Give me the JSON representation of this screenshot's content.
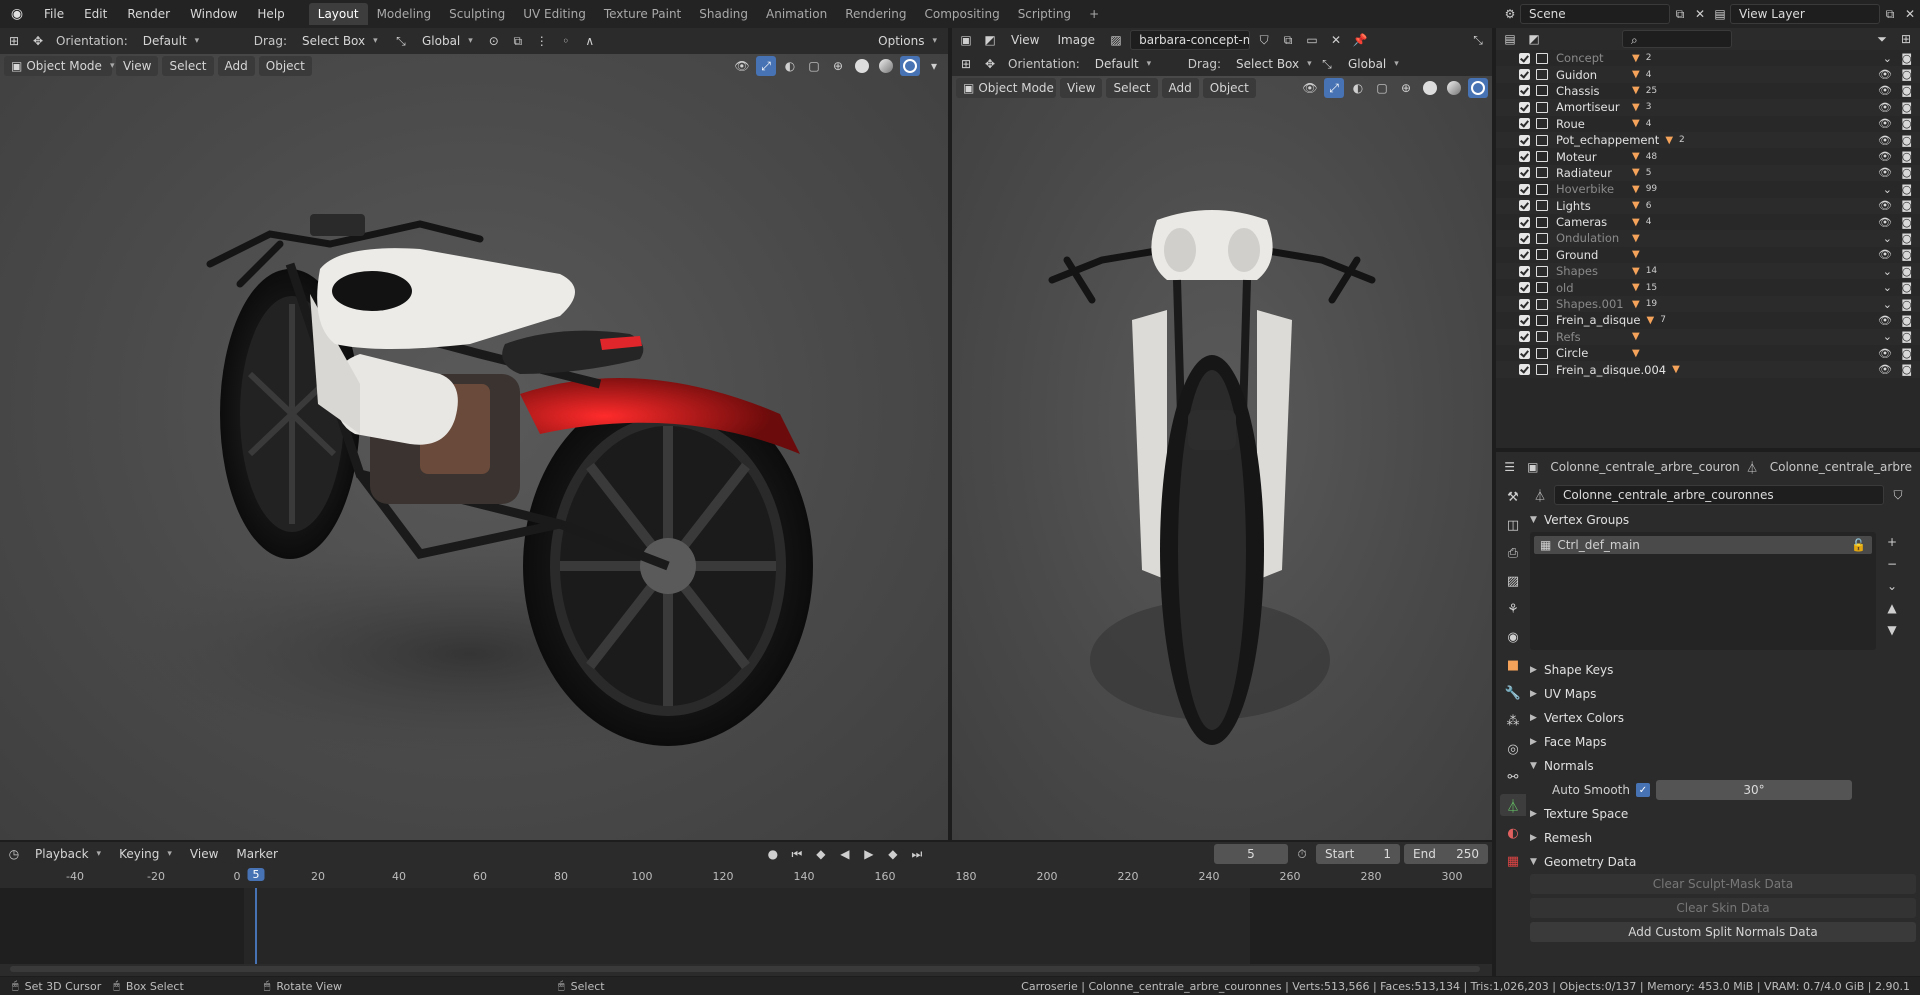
{
  "menubar": {
    "items": [
      "File",
      "Edit",
      "Render",
      "Window",
      "Help"
    ],
    "workspaces": [
      "Layout",
      "Modeling",
      "Sculpting",
      "UV Editing",
      "Texture Paint",
      "Shading",
      "Animation",
      "Rendering",
      "Compositing",
      "Scripting"
    ],
    "active_workspace": "Layout",
    "add_tab": "+",
    "scene": "Scene",
    "view_layer": "View Layer"
  },
  "viewport_left": {
    "orientation_label": "Orientation:",
    "orientation_value": "Default",
    "drag_label": "Drag:",
    "drag_value": "Select Box",
    "transform_value": "Global",
    "options": "Options",
    "mode": "Object Mode",
    "menus": [
      "View",
      "Select",
      "Add",
      "Object"
    ]
  },
  "image_editor": {
    "menus": [
      "View",
      "Image"
    ],
    "image_name": "barbara-concept-mo...",
    "orientation_label": "Orientation:",
    "orientation_value": "Default",
    "drag_label": "Drag:",
    "drag_value": "Select Box",
    "transform_value": "Global",
    "mode": "Object Mode",
    "menus2": [
      "View",
      "Select",
      "Add",
      "Object"
    ]
  },
  "outliner": {
    "search_placeholder": "",
    "rows": [
      {
        "name": "Concept",
        "dim": true,
        "badge": "2"
      },
      {
        "name": "Guidon",
        "dim": false,
        "badge": "4"
      },
      {
        "name": "Chassis",
        "dim": false,
        "badge": "25"
      },
      {
        "name": "Amortiseur",
        "dim": false,
        "badge": "3"
      },
      {
        "name": "Roue",
        "dim": false,
        "badge": "4"
      },
      {
        "name": "Pot_echappement",
        "dim": false,
        "badge": "2"
      },
      {
        "name": "Moteur",
        "dim": false,
        "badge": "48"
      },
      {
        "name": "Radiateur",
        "dim": false,
        "badge": "5"
      },
      {
        "name": "Hoverbike",
        "dim": true,
        "badge": "99"
      },
      {
        "name": "Lights",
        "dim": false,
        "badge": "6"
      },
      {
        "name": "Cameras",
        "dim": false,
        "badge": "4"
      },
      {
        "name": "Ondulation",
        "dim": true,
        "badge": ""
      },
      {
        "name": "Ground",
        "dim": false,
        "badge": ""
      },
      {
        "name": "Shapes",
        "dim": true,
        "badge": "14"
      },
      {
        "name": "old",
        "dim": true,
        "badge": "15"
      },
      {
        "name": "Shapes.001",
        "dim": true,
        "badge": "19"
      },
      {
        "name": "Frein_a_disque",
        "dim": false,
        "badge": "7"
      },
      {
        "name": "Refs",
        "dim": true,
        "badge": ""
      },
      {
        "name": "Circle",
        "dim": false,
        "badge": ""
      },
      {
        "name": "Frein_a_disque.004",
        "dim": false,
        "badge": ""
      }
    ]
  },
  "properties": {
    "object_name": "Colonne_centrale_arbre_couronnes",
    "mesh_name_tab": "Colonne_centrale_arbre",
    "mesh_name": "Colonne_centrale_arbre_couronnes",
    "vertex_groups_title": "Vertex Groups",
    "vertex_group": "Ctrl_def_main",
    "panels": [
      "Shape Keys",
      "UV Maps",
      "Vertex Colors",
      "Face Maps"
    ],
    "normals_title": "Normals",
    "auto_smooth_label": "Auto Smooth",
    "auto_smooth_angle": "30°",
    "panels2": [
      "Texture Space",
      "Remesh"
    ],
    "geometry_data_title": "Geometry Data",
    "clear_sculpt_mask": "Clear Sculpt-Mask Data",
    "clear_skin": "Clear Skin Data",
    "add_custom_split": "Add Custom Split Normals Data"
  },
  "timeline": {
    "menus": [
      "Playback",
      "Keying",
      "View",
      "Marker"
    ],
    "current_frame": "5",
    "start_label": "Start",
    "start": "1",
    "end_label": "End",
    "end": "250",
    "ticks": [
      "-40",
      "-20",
      "0",
      "20",
      "40",
      "60",
      "80",
      "100",
      "120",
      "140",
      "160",
      "180",
      "200",
      "220",
      "240",
      "260",
      "280",
      "300"
    ],
    "indicator": "5"
  },
  "statusbar": {
    "set_cursor": "Set 3D Cursor",
    "box_select": "Box Select",
    "rotate_view": "Rotate View",
    "select": "Select",
    "stats": "Carroserie | Colonne_centrale_arbre_couronnes | Verts:513,566 | Faces:513,134 | Tris:1,026,203 | Objects:0/137 | Memory: 453.0 MiB | VRAM: 0.7/4.0 GiB | 2.90.1"
  },
  "colors": {
    "accent": "#4772b3",
    "object_orange": "#f5a35a",
    "bike_white": "#e8e6e2",
    "fender_red": "#e0262a"
  }
}
